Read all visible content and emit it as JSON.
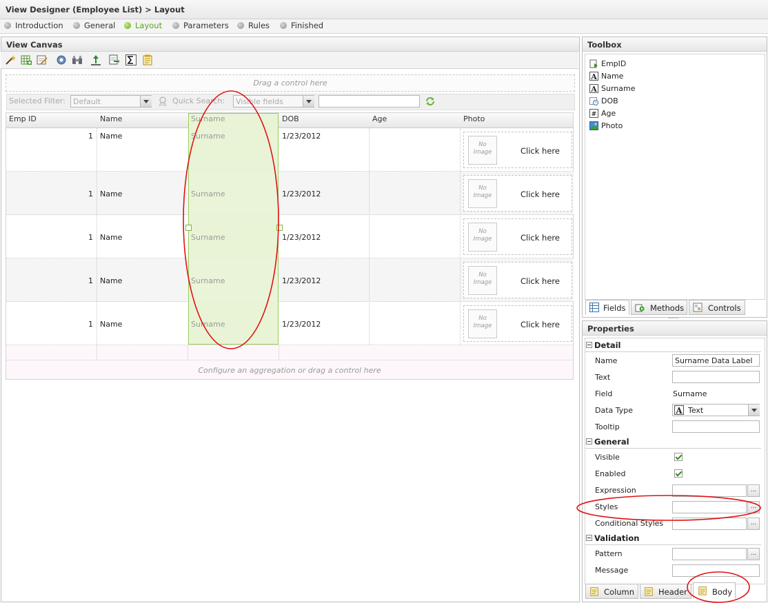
{
  "window": {
    "title": "View Designer (Employee List) > Layout"
  },
  "wizard_steps": [
    {
      "label": "Introduction",
      "active": false
    },
    {
      "label": "General",
      "active": false
    },
    {
      "label": "Layout",
      "active": true
    },
    {
      "label": "Parameters",
      "active": false
    },
    {
      "label": "Rules",
      "active": false
    },
    {
      "label": "Finished",
      "active": false
    }
  ],
  "canvas": {
    "title": "View Canvas",
    "toolbar_icons": [
      "wizard-icon",
      "add-table-icon",
      "edit-icon",
      "settings-icon",
      "binoculars-icon",
      "upload-icon",
      "export-icon",
      "sigma-icon",
      "notes-icon"
    ],
    "drag_hint_top": "Drag a control here",
    "filter": {
      "selected_filter_label": "Selected Filter:",
      "selected_filter_value": "Default",
      "quick_search_label": "Quick Search:",
      "quick_search_value": "Visible fields",
      "search_value": ""
    },
    "columns": [
      "Emp ID",
      "Name",
      "Surname",
      "DOB",
      "Age",
      "Photo"
    ],
    "rows": [
      {
        "empid": "1",
        "name": "Name",
        "surname": "Surname",
        "dob": "1/23/2012",
        "age": "",
        "photo_placeholder_line1": "No",
        "photo_placeholder_line2": "Image",
        "photo_action": "Click here"
      },
      {
        "empid": "1",
        "name": "Name",
        "surname": "Surname",
        "dob": "1/23/2012",
        "age": "",
        "photo_placeholder_line1": "No",
        "photo_placeholder_line2": "Image",
        "photo_action": "Click here"
      },
      {
        "empid": "1",
        "name": "Name",
        "surname": "Surname",
        "dob": "1/23/2012",
        "age": "",
        "photo_placeholder_line1": "No",
        "photo_placeholder_line2": "Image",
        "photo_action": "Click here"
      },
      {
        "empid": "1",
        "name": "Name",
        "surname": "Surname",
        "dob": "1/23/2012",
        "age": "",
        "photo_placeholder_line1": "No",
        "photo_placeholder_line2": "Image",
        "photo_action": "Click here"
      },
      {
        "empid": "1",
        "name": "Name",
        "surname": "Surname",
        "dob": "1/23/2012",
        "age": "",
        "photo_placeholder_line1": "No",
        "photo_placeholder_line2": "Image",
        "photo_action": "Click here"
      }
    ],
    "footer_hint": "Configure an aggregation or drag a control here"
  },
  "toolbox": {
    "title": "Toolbox",
    "items": [
      {
        "label": "EmpID",
        "icon": "autonumber-icon"
      },
      {
        "label": "Name",
        "icon": "text-field-icon"
      },
      {
        "label": "Surname",
        "icon": "text-field-icon"
      },
      {
        "label": "DOB",
        "icon": "date-field-icon"
      },
      {
        "label": "Age",
        "icon": "number-field-icon"
      },
      {
        "label": "Photo",
        "icon": "image-field-icon"
      }
    ],
    "tabs": [
      {
        "label": "Fields",
        "selected": true
      },
      {
        "label": "Methods",
        "selected": false
      },
      {
        "label": "Controls",
        "selected": false
      }
    ]
  },
  "properties": {
    "title": "Properties",
    "sections": {
      "detail": "Detail",
      "general": "General",
      "validation": "Validation"
    },
    "fields": {
      "name_label": "Name",
      "name_value": "Surname Data Label",
      "text_label": "Text",
      "text_value": "",
      "field_label": "Field",
      "field_value": "Surname",
      "datatype_label": "Data Type",
      "datatype_value": "Text",
      "tooltip_label": "Tooltip",
      "tooltip_value": "",
      "visible_label": "Visible",
      "visible_checked": true,
      "enabled_label": "Enabled",
      "enabled_checked": true,
      "expression_label": "Expression",
      "expression_value": "",
      "styles_label": "Styles",
      "styles_value": "",
      "conditional_styles_label": "Conditional Styles",
      "conditional_styles_value": "",
      "pattern_label": "Pattern",
      "pattern_value": "",
      "message_label": "Message",
      "message_value": "",
      "ellipsis": "..."
    },
    "tabs": [
      {
        "label": "Column",
        "selected": false
      },
      {
        "label": "Header",
        "selected": false
      },
      {
        "label": "Body",
        "selected": true
      }
    ]
  },
  "colors": {
    "active_step": "#58a41f",
    "selection_fill": "#e9f4d6",
    "selection_border": "#9ccc5d",
    "annotation_red": "#e01010"
  }
}
